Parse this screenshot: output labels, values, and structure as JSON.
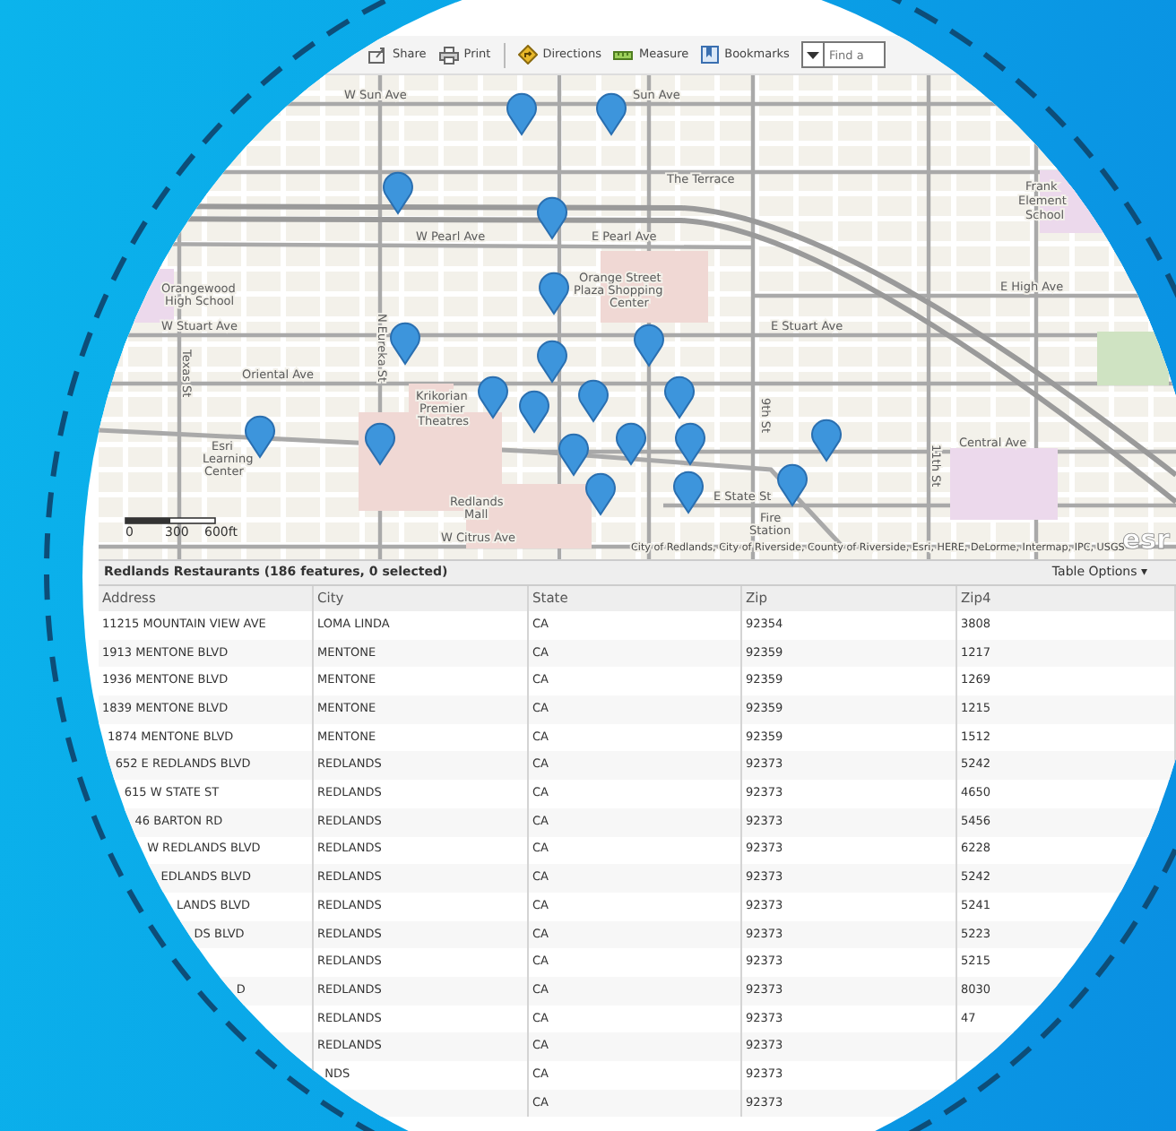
{
  "toolbar": {
    "items": [
      {
        "kind": "share",
        "label": "Share"
      },
      {
        "kind": "print",
        "label": "Print"
      },
      {
        "kind": "directions",
        "label": "Directions"
      },
      {
        "kind": "measure",
        "label": "Measure"
      },
      {
        "kind": "bookmarks",
        "label": "Bookmarks"
      }
    ],
    "search": {
      "placeholder": "Find a"
    }
  },
  "map": {
    "labels": [
      "W Sun Ave",
      "Sun Ave",
      "The Terrace",
      "Frank",
      "Element",
      "School",
      "W Pearl Ave",
      "E Pearl Ave",
      "Orangewood",
      "High School",
      "Orange Street",
      "Plaza Shopping",
      "Center",
      "E High Ave",
      "W Stuart Ave",
      "E Stuart Ave",
      "Oriental Ave",
      "Krikorian",
      "Premier",
      "Theatres",
      "Esri",
      "Learning",
      "Center",
      "Redlands",
      "Mall",
      "Central Ave",
      "E State St",
      "Fire",
      "Station",
      "W Citrus Ave",
      "Texas St",
      "N Eureka St",
      "9th St",
      "11th St"
    ],
    "scale_labels": [
      "0",
      "300",
      "600ft"
    ],
    "attribution": "City of Redlands, City of Riverside, County of Riverside, Esri, HERE, DeLorme, Intermap, IPC, USGS",
    "logo": "esr"
  },
  "table": {
    "title": "Redlands Restaurants (186 features, 0 selected)",
    "options": "Table Options ▾",
    "columns": [
      "Address",
      "City",
      "State",
      "Zip",
      "Zip4"
    ],
    "rows": [
      [
        "11215 MOUNTAIN VIEW AVE",
        "LOMA LINDA",
        "CA",
        "92354",
        "3808"
      ],
      [
        "1913 MENTONE BLVD",
        "MENTONE",
        "CA",
        "92359",
        "1217"
      ],
      [
        "1936 MENTONE BLVD",
        "MENTONE",
        "CA",
        "92359",
        "1269"
      ],
      [
        "1839 MENTONE BLVD",
        "MENTONE",
        "CA",
        "92359",
        "1215"
      ],
      [
        "1874 MENTONE BLVD",
        "MENTONE",
        "CA",
        "92359",
        "1512"
      ],
      [
        "652 E REDLANDS BLVD",
        "REDLANDS",
        "CA",
        "92373",
        "5242"
      ],
      [
        "615 W STATE ST",
        "REDLANDS",
        "CA",
        "92373",
        "4650"
      ],
      [
        "46 BARTON RD",
        "REDLANDS",
        "CA",
        "92373",
        "5456"
      ],
      [
        "W REDLANDS BLVD",
        "REDLANDS",
        "CA",
        "92373",
        "6228"
      ],
      [
        "EDLANDS BLVD",
        "REDLANDS",
        "CA",
        "92373",
        "5242"
      ],
      [
        "LANDS BLVD",
        "REDLANDS",
        "CA",
        "92373",
        "5241"
      ],
      [
        "DS BLVD",
        "REDLANDS",
        "CA",
        "92373",
        "5223"
      ],
      [
        null,
        "REDLANDS",
        "CA",
        "92373",
        "5215"
      ],
      [
        "D",
        "REDLANDS",
        "CA",
        "92373",
        "8030"
      ],
      [
        null,
        "REDLANDS",
        "CA",
        "92373",
        "47"
      ],
      [
        null,
        "REDLANDS",
        "CA",
        "92373",
        null
      ],
      [
        null,
        "NDS",
        "CA",
        "92373",
        null
      ],
      [
        null,
        null,
        "CA",
        "92373",
        null
      ]
    ]
  }
}
